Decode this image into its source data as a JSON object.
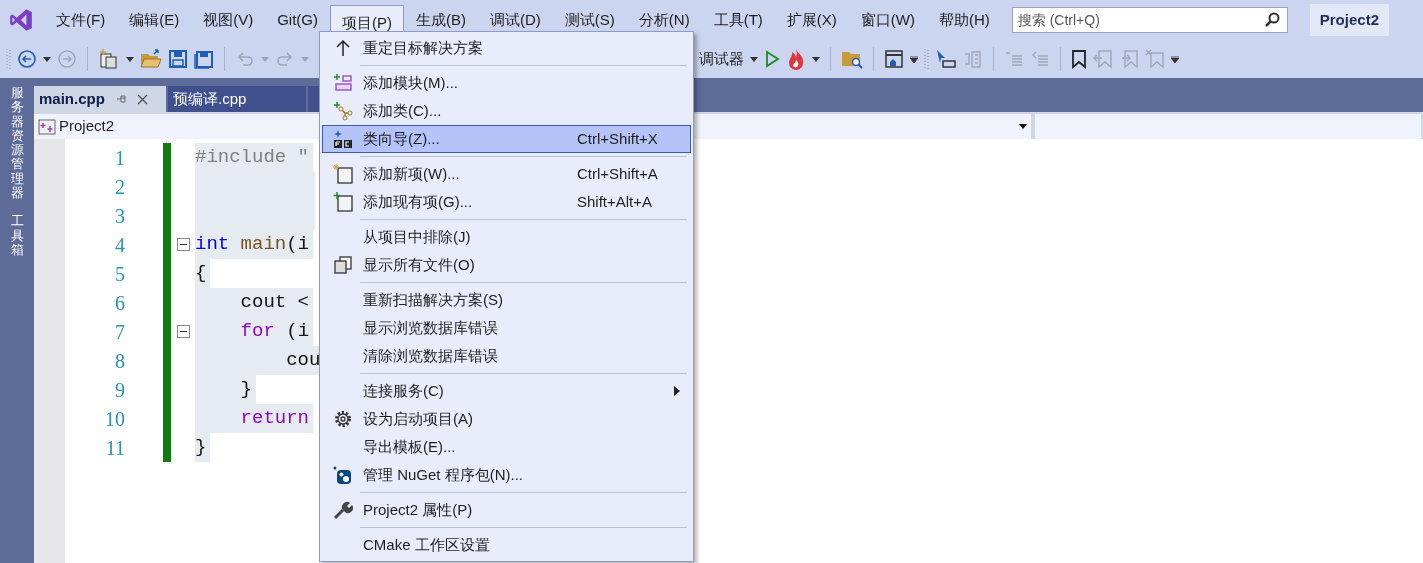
{
  "menubar": [
    {
      "label": "文件(F)",
      "selected": false
    },
    {
      "label": "编辑(E)",
      "selected": false
    },
    {
      "label": "视图(V)",
      "selected": false
    },
    {
      "label": "Git(G)",
      "selected": false
    },
    {
      "label": "项目(P)",
      "selected": true
    },
    {
      "label": "生成(B)",
      "selected": false
    },
    {
      "label": "调试(D)",
      "selected": false
    },
    {
      "label": "测试(S)",
      "selected": false
    },
    {
      "label": "分析(N)",
      "selected": false
    },
    {
      "label": "工具(T)",
      "selected": false
    },
    {
      "label": "扩展(X)",
      "selected": false
    },
    {
      "label": "窗口(W)",
      "selected": false
    },
    {
      "label": "帮助(H)",
      "selected": false
    }
  ],
  "search": {
    "placeholder": "搜索 (Ctrl+Q)"
  },
  "project_badge": "Project2",
  "toolbar": {
    "debugger_label": "调试器"
  },
  "side_tabs": [
    "服务器资源管理器",
    "工具箱"
  ],
  "tabs": [
    {
      "label": "main.cpp",
      "selected": true
    },
    {
      "label": "预编译.cpp",
      "selected": false
    }
  ],
  "nav_bar": {
    "project": "Project2"
  },
  "editor": {
    "lines": [
      {
        "number": "1",
        "tokens": [
          {
            "text": "#include \"",
            "kind": "preproc"
          }
        ]
      },
      {
        "number": "2"
      },
      {
        "number": "3"
      },
      {
        "number": "4",
        "fold": true,
        "tokens": [
          {
            "text": "int",
            "kind": "keyword"
          },
          {
            "text": " main",
            "kind": "func"
          },
          {
            "text": "(i",
            "kind": "plain"
          }
        ]
      },
      {
        "number": "5",
        "tokens": [
          {
            "text": "{",
            "kind": "plain"
          }
        ]
      },
      {
        "number": "6",
        "tokens": [
          {
            "text": "    cout <",
            "kind": "plain"
          }
        ]
      },
      {
        "number": "7",
        "fold": true,
        "tokens": [
          {
            "text": "    for",
            "kind": "control"
          },
          {
            "text": " (i",
            "kind": "plain"
          }
        ]
      },
      {
        "number": "8",
        "tokens": [
          {
            "text": "        cou",
            "kind": "plain"
          }
        ]
      },
      {
        "number": "9",
        "tokens": [
          {
            "text": "    }",
            "kind": "plain"
          }
        ]
      },
      {
        "number": "10",
        "tokens": [
          {
            "text": "    return",
            "kind": "control"
          }
        ]
      },
      {
        "number": "11",
        "tokens": [
          {
            "text": "}",
            "kind": "plain"
          }
        ]
      }
    ]
  },
  "project_menu": [
    {
      "kind": "item",
      "label": "重定目标解决方案",
      "selected": false
    },
    {
      "kind": "separator"
    },
    {
      "kind": "item",
      "label": "添加模块(M)...",
      "selected": false
    },
    {
      "kind": "item",
      "label": "添加类(C)...",
      "selected": false
    },
    {
      "kind": "item",
      "label": "类向导(Z)...",
      "shortcut": "Ctrl+Shift+X",
      "selected": true
    },
    {
      "kind": "separator"
    },
    {
      "kind": "item",
      "label": "添加新项(W)...",
      "shortcut": "Ctrl+Shift+A",
      "selected": false
    },
    {
      "kind": "item",
      "label": "添加现有项(G)...",
      "shortcut": "Shift+Alt+A",
      "selected": false
    },
    {
      "kind": "separator"
    },
    {
      "kind": "item",
      "label": "从项目中排除(J)",
      "selected": false
    },
    {
      "kind": "item",
      "label": "显示所有文件(O)",
      "selected": false
    },
    {
      "kind": "separator"
    },
    {
      "kind": "item",
      "label": "重新扫描解决方案(S)",
      "selected": false
    },
    {
      "kind": "item",
      "label": "显示浏览数据库错误",
      "selected": false
    },
    {
      "kind": "item",
      "label": "清除浏览数据库错误",
      "selected": false
    },
    {
      "kind": "separator"
    },
    {
      "kind": "item",
      "label": "连接服务(C)",
      "submenu": true,
      "selected": false
    },
    {
      "kind": "item",
      "label": "设为启动项目(A)",
      "selected": false
    },
    {
      "kind": "item",
      "label": "导出模板(E)...",
      "selected": false
    },
    {
      "kind": "item",
      "label": "管理 NuGet 程序包(N)...",
      "selected": false
    },
    {
      "kind": "separator"
    },
    {
      "kind": "item",
      "label": "Project2 属性(P)",
      "selected": false
    },
    {
      "kind": "separator"
    },
    {
      "kind": "item",
      "label": "CMake 工作区设置",
      "selected": false
    }
  ]
}
